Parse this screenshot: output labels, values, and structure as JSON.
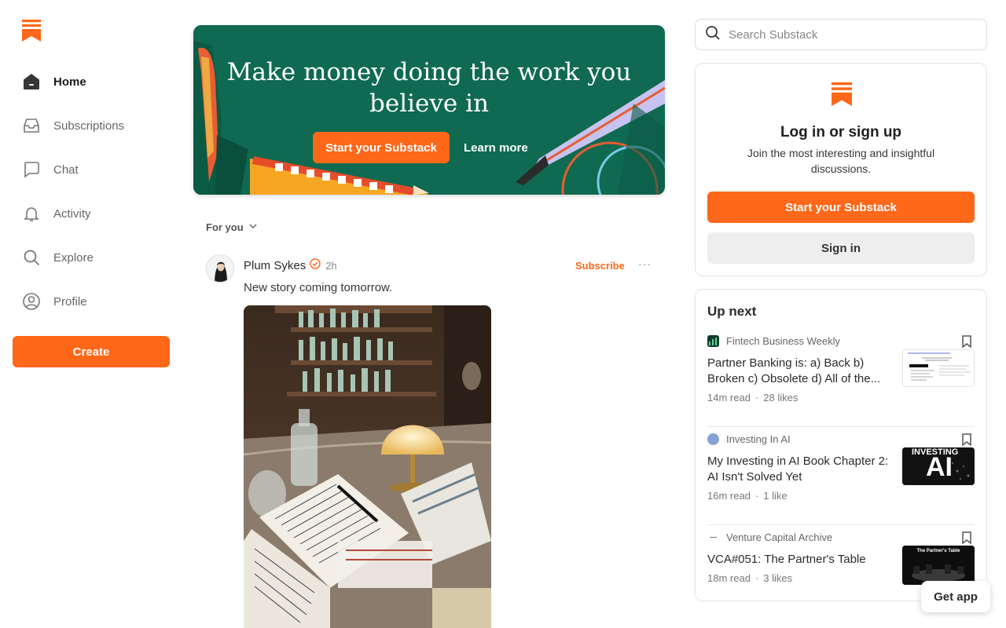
{
  "brand": {
    "accent": "#FF6719",
    "banner_bg": "#0f6a51"
  },
  "sidebar": {
    "logo_icon": "substack-logo-icon",
    "items": [
      {
        "label": "Home",
        "icon": "home-icon",
        "active": true
      },
      {
        "label": "Subscriptions",
        "icon": "inbox-icon"
      },
      {
        "label": "Chat",
        "icon": "chat-bubble-icon"
      },
      {
        "label": "Activity",
        "icon": "bell-icon"
      },
      {
        "label": "Explore",
        "icon": "search-icon"
      },
      {
        "label": "Profile",
        "icon": "user-circle-icon"
      }
    ],
    "create_label": "Create"
  },
  "banner": {
    "title": "Make money doing the work you believe in",
    "cta_label": "Start your Substack",
    "learn_label": "Learn more"
  },
  "feed": {
    "filter_label": "For you",
    "post": {
      "author": "Plum Sykes",
      "time": "2h",
      "subscribe_label": "Subscribe",
      "more_label": "···",
      "text": "New story coming tomorrow."
    }
  },
  "search": {
    "placeholder": "Search Substack"
  },
  "login": {
    "title": "Log in or sign up",
    "subtitle": "Join the most interesting and insightful discussions.",
    "start_label": "Start your Substack",
    "signin_label": "Sign in"
  },
  "upnext": {
    "title": "Up next",
    "items": [
      {
        "publication": "Fintech Business Weekly",
        "title": "Partner Banking is: a) Back b) Broken c) Obsolete d) All of the...",
        "read": "14m read",
        "likes": "28 likes"
      },
      {
        "publication": "Investing In AI",
        "title": "My Investing in AI Book Chapter 2: AI Isn't Solved Yet",
        "read": "16m read",
        "likes": "1 like",
        "thumb_text_1": "INVESTING",
        "thumb_text_2": "AI"
      },
      {
        "publication": "Venture Capital Archive",
        "title": "VCA#051: The Partner's Table",
        "read": "18m read",
        "likes": "3 likes",
        "thumb_text_1": "The Partner's Table"
      }
    ],
    "separator": "·"
  },
  "get_app_label": "Get app"
}
